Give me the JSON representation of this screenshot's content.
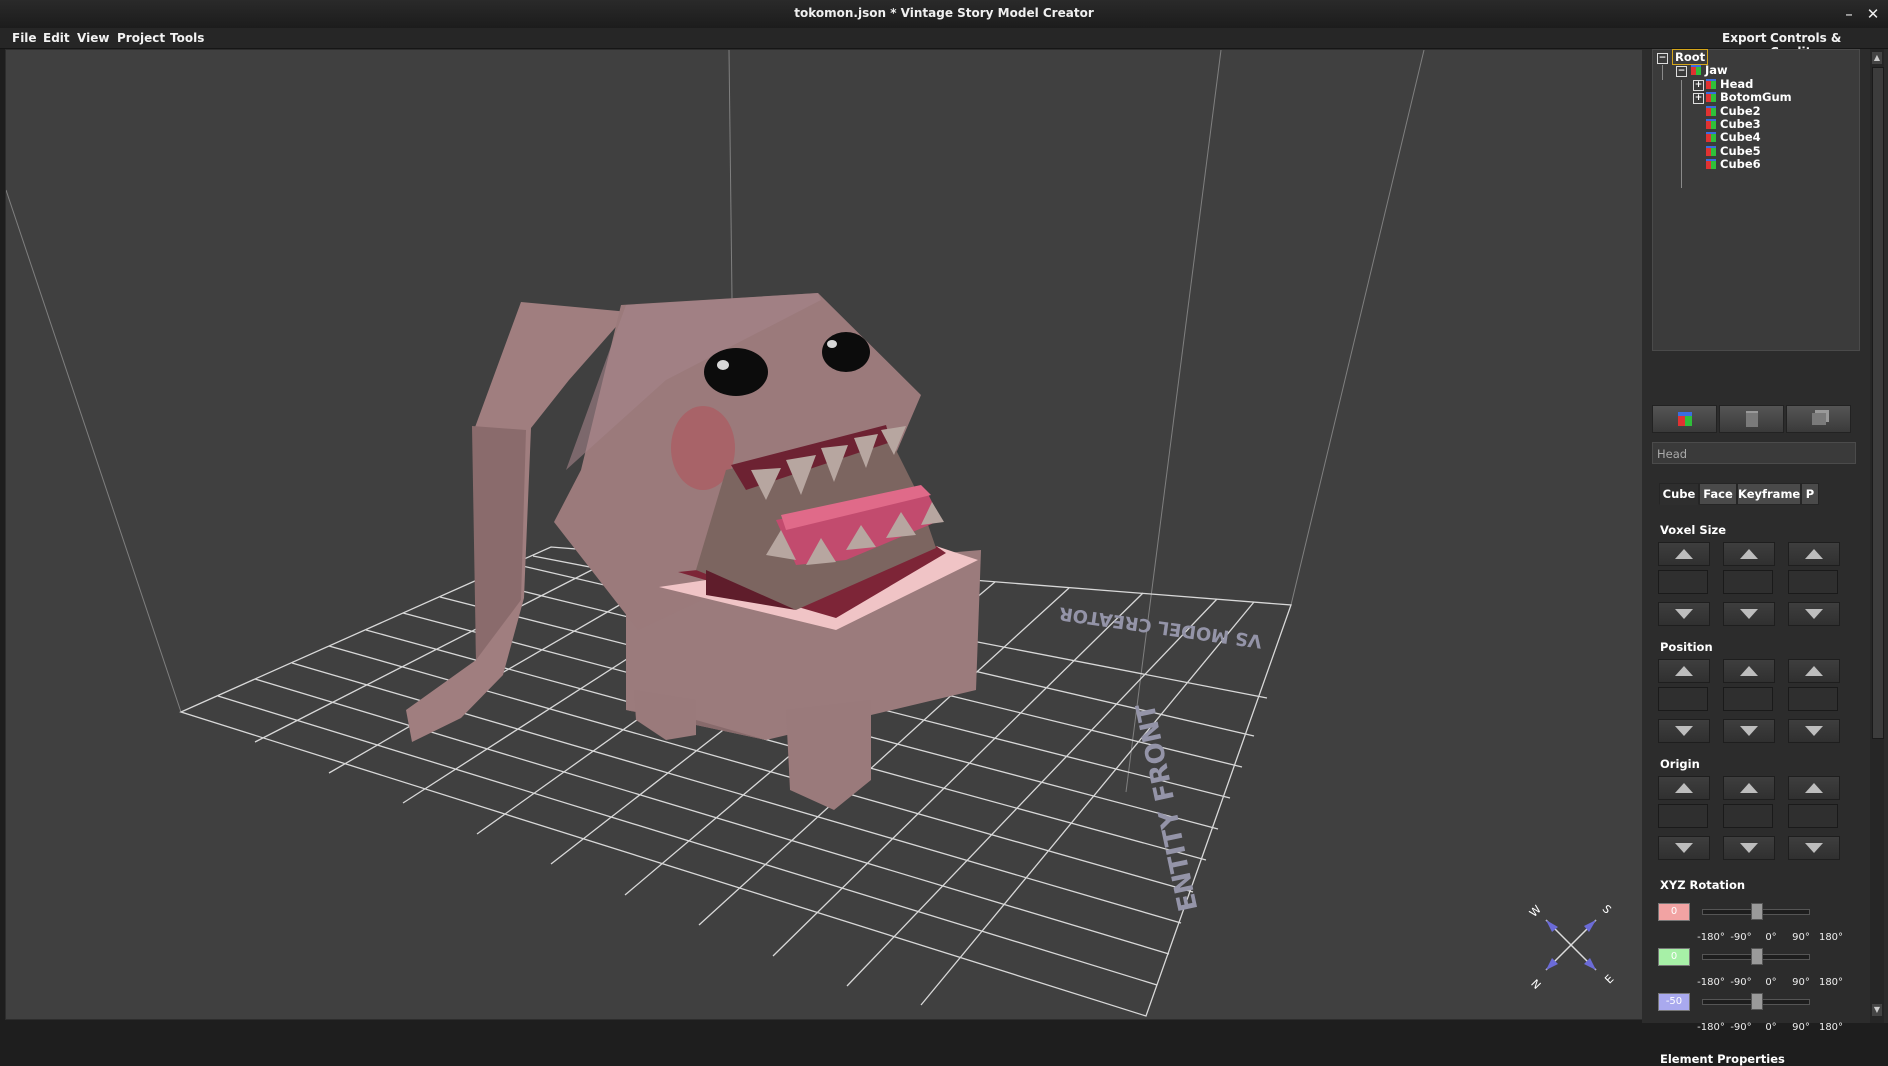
{
  "window": {
    "title": "tokomon.json * Vintage Story Model Creator",
    "minimize": "–",
    "maximize": "□",
    "close": "✕"
  },
  "menubar": {
    "left": [
      "File",
      "Edit",
      "View",
      "Project",
      "Tools"
    ],
    "right": [
      "Export",
      "Controls & Credits"
    ]
  },
  "viewport": {
    "floor_label_back": "VS MODEL CREATOR",
    "floor_label_front": "ENTITY FRONT",
    "compass": {
      "n": "N",
      "s": "S",
      "e": "E",
      "w": "W"
    }
  },
  "tree": {
    "root": "Root",
    "jaw": "Jaw",
    "children": [
      "Head",
      "BotomGum",
      "Cube2",
      "Cube3",
      "Cube4",
      "Cube5",
      "Cube6"
    ]
  },
  "toolbar": {
    "add": "add-cube-icon",
    "delete": "trash-icon",
    "duplicate": "copy-icon"
  },
  "element_name": "Head",
  "tabs": [
    "Cube",
    "Face",
    "Keyframe",
    "P"
  ],
  "active_tab": "Cube",
  "sections": {
    "voxel_size": "Voxel Size",
    "position": "Position",
    "origin": "Origin",
    "xyz_rotation": "XYZ Rotation",
    "element_properties": "Element Properties"
  },
  "rotation": {
    "x": "0",
    "y": "0",
    "z": "-50",
    "x_color": "#f2a3a3",
    "y_color": "#a7f0a7",
    "z_color": "#a9a9ee",
    "ticks": [
      "-180°",
      "-90°",
      "0°",
      "90°",
      "180°"
    ]
  }
}
